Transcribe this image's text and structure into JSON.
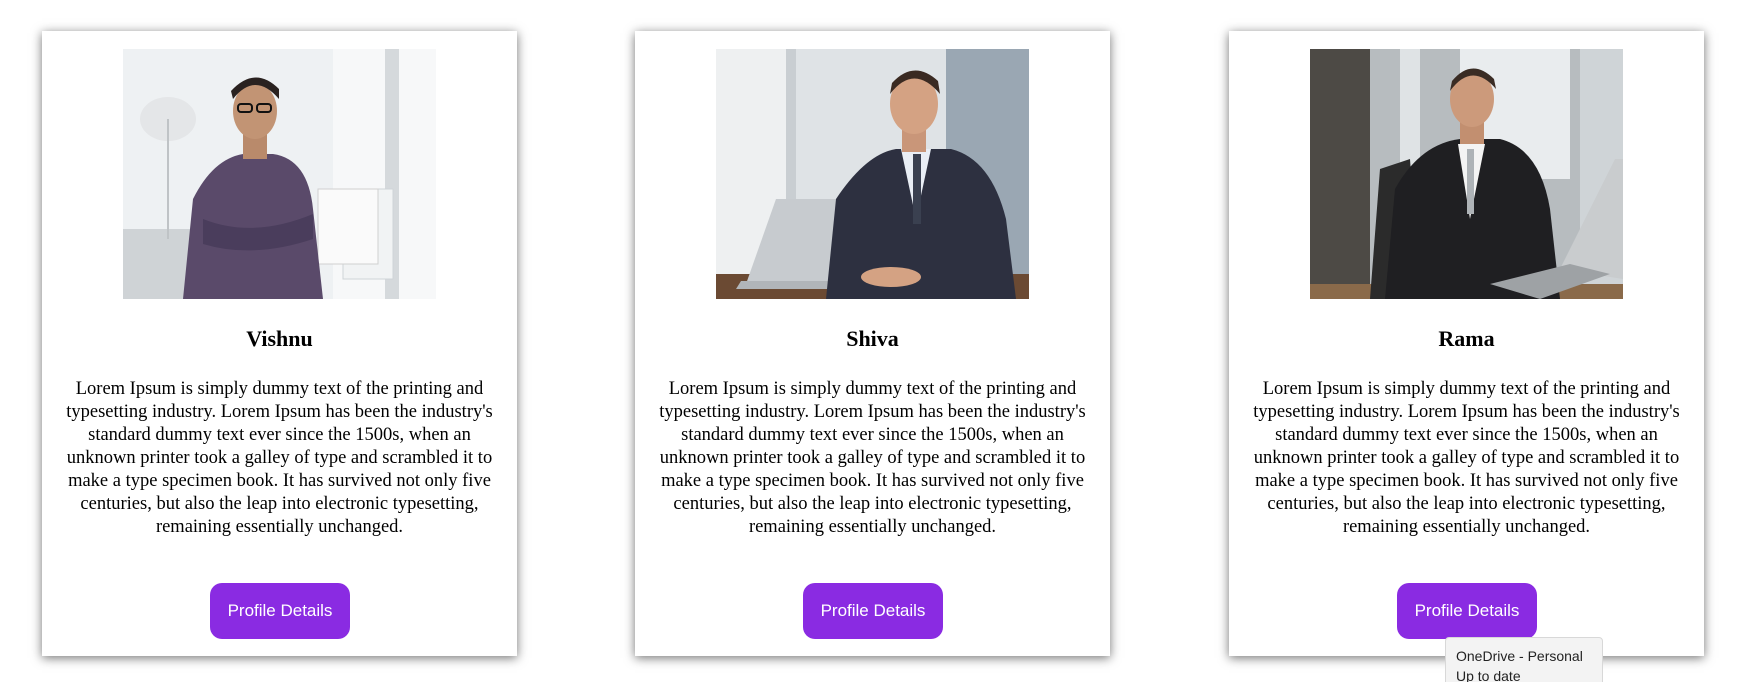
{
  "cards": [
    {
      "name": "Vishnu",
      "bio": "Lorem Ipsum is simply dummy text of the printing and typesetting industry. Lorem Ipsum has been the industry's standard dummy text ever since the 1500s, when an unknown printer took a galley of type and scrambled it to make a type specimen book. It has survived not only five centuries, but also the leap into electronic typesetting, remaining essentially unchanged.",
      "button_label": "Profile Details"
    },
    {
      "name": "Shiva",
      "bio": "Lorem Ipsum is simply dummy text of the printing and typesetting industry. Lorem Ipsum has been the industry's standard dummy text ever since the 1500s, when an unknown printer took a galley of type and scrambled it to make a type specimen book. It has survived not only five centuries, but also the leap into electronic typesetting, remaining essentially unchanged.",
      "button_label": "Profile Details"
    },
    {
      "name": "Rama",
      "bio": "Lorem Ipsum is simply dummy text of the printing and typesetting industry. Lorem Ipsum has been the industry's standard dummy text ever since the 1500s, when an unknown printer took a galley of type and scrambled it to make a type specimen book. It has survived not only five centuries, but also the leap into electronic typesetting, remaining essentially unchanged.",
      "button_label": "Profile Details"
    }
  ],
  "tooltip": {
    "line1": "OneDrive - Personal",
    "line2": "Up to date"
  },
  "colors": {
    "button": "#8a2be2",
    "button_text": "#ffffff"
  }
}
